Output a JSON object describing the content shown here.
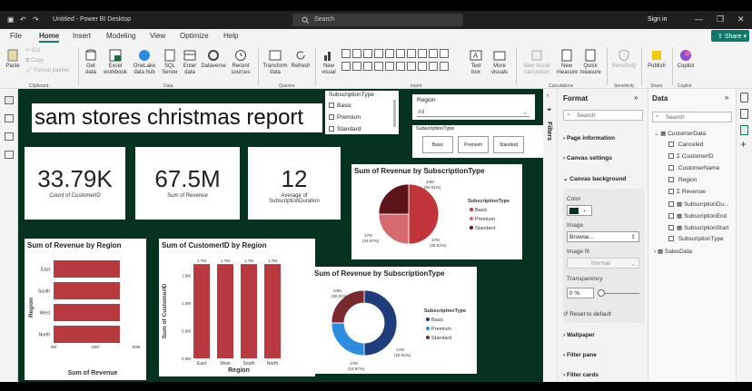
{
  "titlebar": {
    "title": "Untitled - Power BI Desktop",
    "search_placeholder": "Search",
    "signin": "Sign in"
  },
  "menu": {
    "items": [
      "File",
      "Home",
      "Insert",
      "Modeling",
      "View",
      "Optimize",
      "Help"
    ],
    "active": "Home",
    "share": "Share"
  },
  "ribbon": {
    "clipboard": {
      "paste": "Paste",
      "cut": "Cut",
      "copy": "Copy",
      "format_painter": "Format painter",
      "group": "Clipboard"
    },
    "data": {
      "get_data": "Get data",
      "excel": "Excel workbook",
      "onelake": "OneLake data hub",
      "sql": "SQL Server",
      "enter": "Enter data",
      "dataverse": "Dataverse",
      "recent": "Recent sources",
      "group": "Data"
    },
    "queries": {
      "transform": "Transform data",
      "refresh": "Refresh",
      "group": "Queries"
    },
    "insert": {
      "new_visual": "New visual",
      "text_box": "Text box",
      "more_visuals": "More visuals",
      "group": "Insert"
    },
    "calculations": {
      "new_visual_calc": "New visual calculation",
      "new_measure": "New measure",
      "quick_measure": "Quick measure",
      "group": "Calculations"
    },
    "sensitivity": {
      "label": "Sensitivity",
      "group": "Sensitivity"
    },
    "share": {
      "publish": "Publish",
      "group": "Share"
    },
    "copilot": {
      "label": "Copilot",
      "group": "Copilot"
    }
  },
  "report": {
    "title": "sam stores christmas report",
    "cards": [
      {
        "value": "33.79K",
        "label": "Count of CustomerID"
      },
      {
        "value": "67.5M",
        "label": "Sum of Revenue"
      },
      {
        "value": "12",
        "label": "Average of SubscriptionDuration"
      }
    ],
    "slicer_subscription": {
      "title": "SubscriptionType",
      "options": [
        "Basic",
        "Premium",
        "Standard"
      ]
    },
    "slicer_region": {
      "title": "Region",
      "value": "All"
    },
    "button_slicer": {
      "title": "SubscriptionType",
      "options": [
        "Basic",
        "Premium",
        "Standard"
      ]
    }
  },
  "chart_data": [
    {
      "type": "pie",
      "title": "Sum of Revenue by SubscriptionType",
      "legend_title": "SubscriptionType",
      "categories": [
        "Basic",
        "Premium",
        "Standard"
      ],
      "values": [
        50.01,
        25.02,
        24.97
      ],
      "labels": [
        "34M (50.01%)",
        "17M (25.02%)",
        "17M (24.97%)"
      ],
      "colors": [
        "#c0353a",
        "#d56b6e",
        "#5d1418"
      ]
    },
    {
      "type": "bar",
      "orientation": "horizontal",
      "title": "Sum of Revenue by Region",
      "categories": [
        "East",
        "South",
        "West",
        "North"
      ],
      "values": [
        17,
        17,
        17,
        17
      ],
      "xlabel": "Sum of Revenue",
      "ylabel": "Region",
      "xticks": [
        "0M",
        "10M",
        "20M"
      ],
      "xlim": [
        0,
        20
      ],
      "color": "#b83a3f"
    },
    {
      "type": "bar",
      "title": "Sum of CustomerID by Region",
      "categories": [
        "East",
        "West",
        "South",
        "North"
      ],
      "values": [
        1.7,
        1.7,
        1.7,
        1.7
      ],
      "labels": [
        "1.7M",
        "1.7M",
        "1.7M",
        "1.7M"
      ],
      "yticks": [
        "0.0M",
        "0.5M",
        "1.0M",
        "1.5M"
      ],
      "ylim": [
        0,
        1.8
      ],
      "xlabel": "Region",
      "ylabel": "Sum of CustomerID",
      "color": "#b83a3f"
    },
    {
      "type": "pie",
      "donut": true,
      "title": "Sum of Revenue by SubscriptionType",
      "legend_title": "SubscriptionType",
      "categories": [
        "Basic",
        "Premium",
        "Standard"
      ],
      "values": [
        50.01,
        25.02,
        24.97
      ],
      "labels": [
        "34M (50.01%)",
        "17M (25.02%)",
        "17M (24.97%)"
      ],
      "colors": [
        "#1f3d7a",
        "#2b8ce0",
        "#7a2a2e"
      ]
    }
  ],
  "format_pane": {
    "title": "Format",
    "search": "Search",
    "sections": [
      "Page information",
      "Canvas settings",
      "Canvas background"
    ],
    "color_label": "Color",
    "image_label": "Image",
    "browse": "Browse...",
    "image_fit_label": "Image fit",
    "image_fit": "Normal",
    "transparency_label": "Transparency",
    "transparency": "0 %",
    "reset": "Reset to default",
    "more_sections": [
      "Wallpaper",
      "Filter pane",
      "Filter cards"
    ],
    "bg_color": "#05331f"
  },
  "filters_label": "Filters",
  "data_pane": {
    "title": "Data",
    "search": "Search",
    "tables": [
      {
        "name": "CustomerData",
        "fields": [
          "Canceled",
          "CustomerID",
          "CustomerName",
          "Region",
          "Revenue",
          "SubscriptionDu...",
          "SubscriptionEnd",
          "SubscriptionStart",
          "SubscriptionType"
        ]
      },
      {
        "name": "SalesData",
        "fields": []
      }
    ]
  }
}
